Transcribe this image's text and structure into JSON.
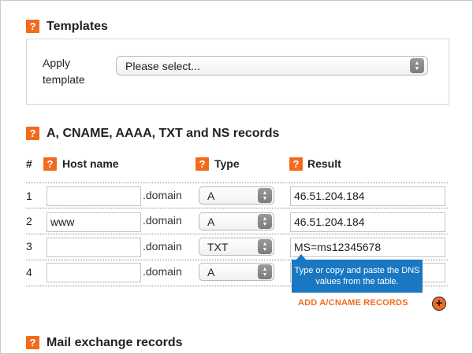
{
  "help_glyph": "?",
  "templates": {
    "heading": "Templates",
    "apply_label": "Apply template",
    "select_value": "Please select..."
  },
  "records": {
    "heading": "A, CNAME, AAAA, TXT and NS records",
    "columns": {
      "num": "#",
      "host": "Host name",
      "type": "Type",
      "result": "Result"
    },
    "rows": [
      {
        "num": "1",
        "host": "",
        "suffix": ".domain",
        "type": "A",
        "result": "46.51.204.184"
      },
      {
        "num": "2",
        "host": "www",
        "suffix": ".domain",
        "type": "A",
        "result": "46.51.204.184"
      },
      {
        "num": "3",
        "host": "",
        "suffix": ".domain",
        "type": "TXT",
        "result": "MS=ms12345678"
      },
      {
        "num": "4",
        "host": "",
        "suffix": ".domain",
        "type": "A",
        "result": ""
      }
    ],
    "tooltip": "Type or copy and paste the DNS values from the table.",
    "add_label": "ADD A/CNAME RECORDS",
    "add_glyph": "+"
  },
  "mail": {
    "heading": "Mail exchange records"
  },
  "colors": {
    "accent": "#f26b1d",
    "tooltip": "#1a78c2",
    "stepper": "#8a8a8a"
  },
  "icons": {
    "help": "help-icon",
    "stepper": "select-stepper-icon",
    "add": "plus-circle-icon"
  }
}
